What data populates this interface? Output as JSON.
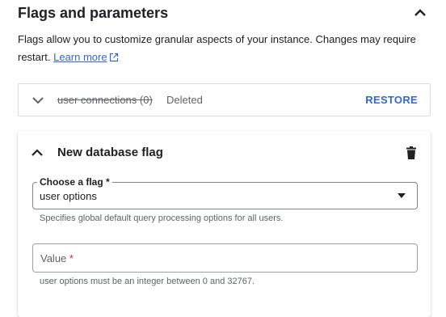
{
  "section": {
    "title": "Flags and parameters",
    "description": "Flags allow you to customize granular aspects of your instance. Changes may require restart.",
    "learn_more": "Learn more"
  },
  "deleted_flag": {
    "name": "user connections (0)",
    "status": "Deleted",
    "restore_label": "RESTORE"
  },
  "new_flag": {
    "title": "New database flag",
    "choose_label": "Choose a flag *",
    "choose_value": "user options",
    "choose_hint": "Specifies global default query processing options for all users.",
    "value_label": "Value",
    "value_required": "*",
    "value_hint": "user options must be an integer between 0 and 32767."
  },
  "colors": {
    "link": "#3367d6",
    "required": "#d93025"
  }
}
